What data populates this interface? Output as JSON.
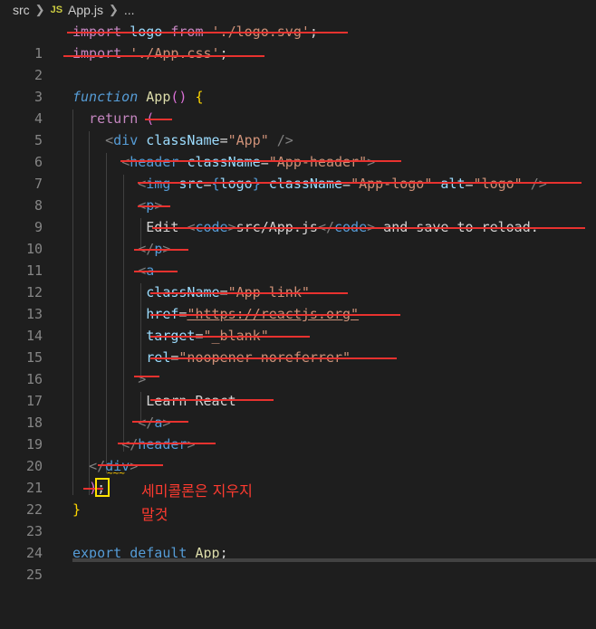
{
  "breadcrumb": {
    "folder": "src",
    "file_icon": "JS",
    "file": "App.js",
    "more": "..."
  },
  "editor": {
    "lines": [
      {
        "n": "1"
      },
      {
        "n": "2"
      },
      {
        "n": "3"
      },
      {
        "n": "4"
      },
      {
        "n": "5"
      },
      {
        "n": "6"
      },
      {
        "n": "7"
      },
      {
        "n": "8"
      },
      {
        "n": "9"
      },
      {
        "n": "10"
      },
      {
        "n": "11"
      },
      {
        "n": "12"
      },
      {
        "n": "13"
      },
      {
        "n": "14"
      },
      {
        "n": "15"
      },
      {
        "n": "16"
      },
      {
        "n": "17"
      },
      {
        "n": "18"
      },
      {
        "n": "19"
      },
      {
        "n": "20"
      },
      {
        "n": "21"
      },
      {
        "n": "22"
      },
      {
        "n": "23"
      },
      {
        "n": "24"
      },
      {
        "n": "25"
      }
    ],
    "code": {
      "l1": {
        "import": "import",
        "logo": "logo",
        "from": "from",
        "path": "'./logo.svg'",
        "semi": ";"
      },
      "l2": {
        "import": "import",
        "path": "'./App.css'",
        "semi": ";"
      },
      "l4": {
        "function": "function",
        "name": "App",
        "parens": "()",
        "brace": "{"
      },
      "l5": {
        "return": "return",
        "paren": "("
      },
      "l6": {
        "open": "<",
        "tag": "div",
        "attr": "className",
        "eq": "=",
        "val": "\"App\"",
        "close": "/>"
      },
      "l7": {
        "open": "<",
        "tag": "header",
        "attr": "className",
        "eq": "=",
        "val": "\"App-header\"",
        "close": ">"
      },
      "l8": {
        "open": "<",
        "tag": "img",
        "attr1": "src",
        "eq1": "=",
        "brace_open": "{",
        "val1": "logo",
        "brace_close": "}",
        "attr2": "className",
        "eq2": "=",
        "val2": "\"App-logo\"",
        "attr3": "alt",
        "eq3": "=",
        "val3": "\"logo\"",
        "close": "/>"
      },
      "l9": {
        "open": "<",
        "tag": "p",
        "close": ">"
      },
      "l10": {
        "text1": "Edit ",
        "code_open_lt": "<",
        "code_open": "code",
        "code_open_gt": ">",
        "text2": "src/App.js",
        "code_close_lt": "</",
        "code_close": "code",
        "code_close_gt": ">",
        "text3": " and save to reload."
      },
      "l11": {
        "open": "</",
        "tag": "p",
        "close": ">"
      },
      "l12": {
        "open": "<",
        "tag": "a"
      },
      "l13": {
        "attr": "className",
        "eq": "=",
        "val": "\"App-link\""
      },
      "l14": {
        "attr": "href",
        "eq": "=",
        "val": "\"https://reactjs.org\""
      },
      "l15": {
        "attr": "target",
        "eq": "=",
        "val": "\"_blank\""
      },
      "l16": {
        "attr": "rel",
        "eq": "=",
        "val": "\"noopener noreferrer\""
      },
      "l17": {
        "close": ">"
      },
      "l18": {
        "text": "Learn React"
      },
      "l19": {
        "open": "</",
        "tag": "a",
        "close": ">"
      },
      "l20": {
        "open": "</",
        "tag": "header",
        "close": ">"
      },
      "l21": {
        "open": "</",
        "tag": "div",
        "close": ">"
      },
      "l22": {
        "paren": ")",
        "semi": ";"
      },
      "l23": {
        "brace": "}"
      },
      "l25": {
        "export": "export",
        "default": "default",
        "name": "App",
        "semi": ";"
      }
    }
  },
  "annotation": {
    "line1": "세미콜론은 지우지",
    "line2": "말것"
  },
  "colors": {
    "background": "#1e1e1e",
    "strike": "#e8322f",
    "highlight_box": "#ffe100",
    "annotation_text": "#ff3b30"
  }
}
